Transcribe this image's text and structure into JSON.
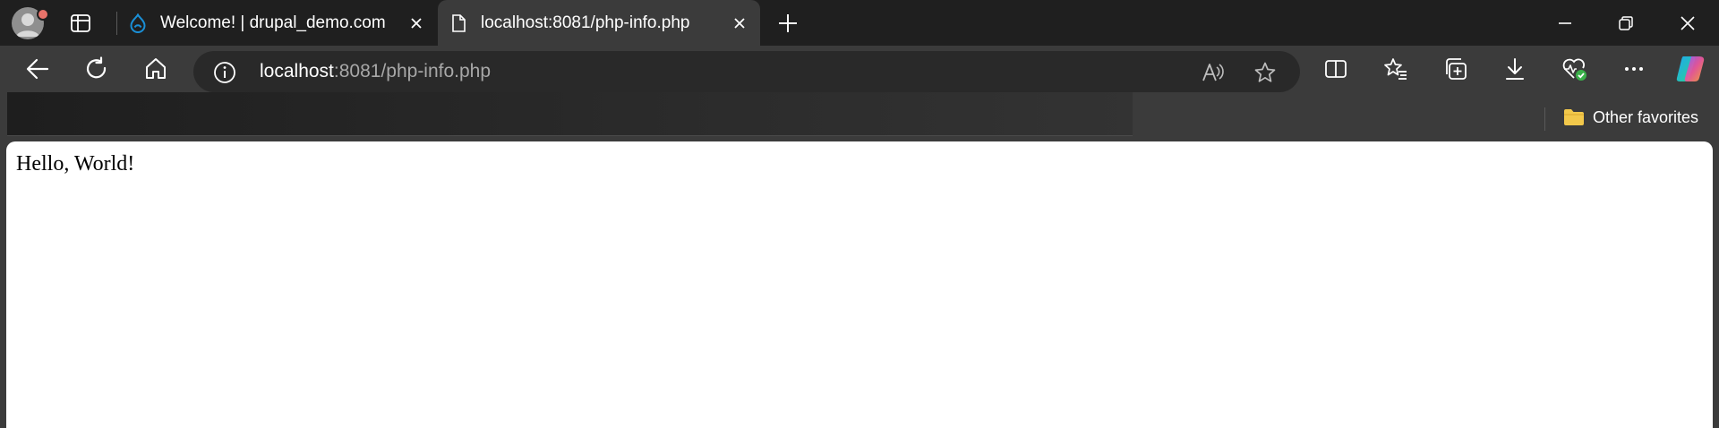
{
  "tabs": [
    {
      "title": "Welcome! | drupal_demo.com",
      "favicon": "drupal-icon",
      "active": false
    },
    {
      "title": "localhost:8081/php-info.php",
      "favicon": "page-icon",
      "active": true
    }
  ],
  "address_bar": {
    "host": "localhost",
    "path": ":8081/php-info.php"
  },
  "favorites_bar": {
    "other_favorites": "Other favorites"
  },
  "page": {
    "content": "Hello, World!"
  },
  "icons": {
    "profile": "avatar",
    "tab_actions": "tab-actions-icon",
    "new_tab": "plus-icon",
    "back": "back-arrow-icon",
    "refresh": "refresh-icon",
    "home": "home-icon",
    "site_info": "info-icon",
    "read_aloud": "read-aloud-icon",
    "favorite": "star-icon",
    "split_screen": "split-screen-icon",
    "favorites": "favorites-icon",
    "collections": "collections-icon",
    "downloads": "download-icon",
    "browser_essentials": "heart-pulse-icon",
    "more": "more-icon",
    "copilot": "copilot-icon"
  },
  "colors": {
    "titlebar": "#1f1f1f",
    "toolbar": "#3b3b3b",
    "address_bar": "#292929",
    "drupal_blue": "#1a8fd6",
    "folder_yellow": "#f2c84b",
    "health_green": "#3ab04a"
  }
}
